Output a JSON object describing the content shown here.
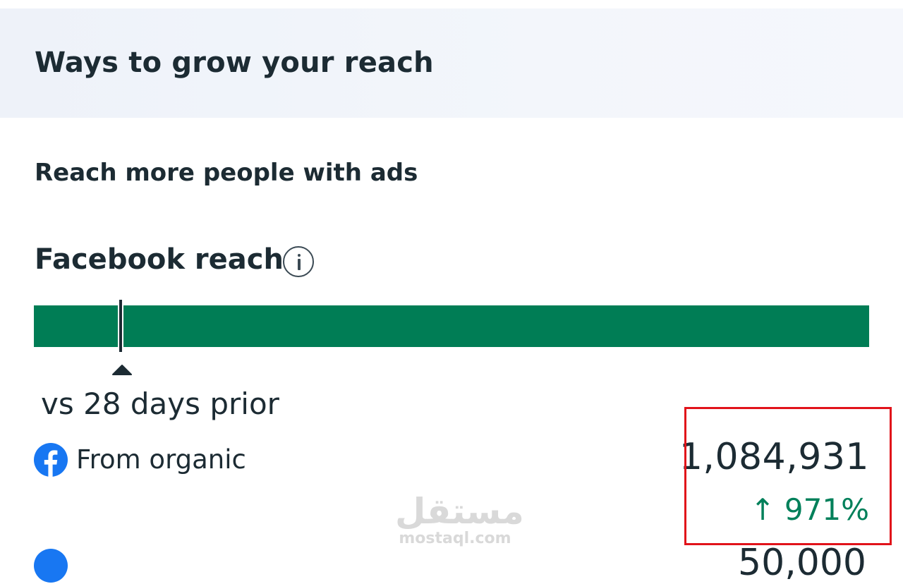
{
  "header": {
    "title": "Ways to grow your reach"
  },
  "section": {
    "title": "Reach more people with ads"
  },
  "metric": {
    "title": "Facebook reach",
    "info_icon": "info-icon",
    "bar_color": "#007d55",
    "marker_fraction": 0.1,
    "comparison_label": "vs 28 days prior"
  },
  "rows": [
    {
      "icon": "facebook-icon",
      "label": "From organic",
      "value": "1,084,931",
      "change_arrow": "↑",
      "change": "971%",
      "change_color": "#00805a",
      "highlight_color": "#e1131a"
    },
    {
      "icon": "facebook-icon",
      "value": "50,000"
    }
  ],
  "watermark": {
    "arabic": "مستقل",
    "latin": "mostaql.com"
  }
}
